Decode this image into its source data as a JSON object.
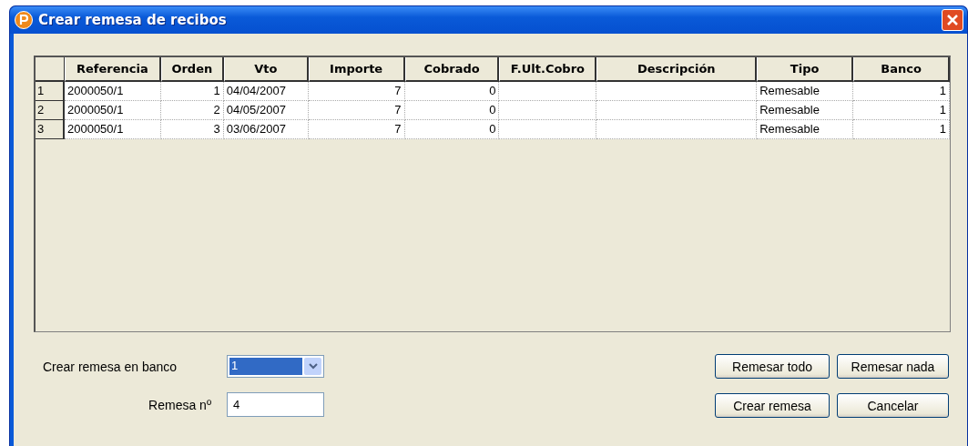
{
  "window": {
    "title": "Crear remesa de recibos"
  },
  "table": {
    "columns": [
      {
        "label": "Referencia",
        "kind": "text"
      },
      {
        "label": "Orden",
        "kind": "number"
      },
      {
        "label": "Vto",
        "kind": "text"
      },
      {
        "label": "Importe",
        "kind": "number"
      },
      {
        "label": "Cobrado",
        "kind": "number"
      },
      {
        "label": "F.Ult.Cobro",
        "kind": "text"
      },
      {
        "label": "Descripción",
        "kind": "text"
      },
      {
        "label": "Tipo",
        "kind": "text"
      },
      {
        "label": "Banco",
        "kind": "number"
      }
    ],
    "rows": [
      {
        "number": "1",
        "cells": [
          "2000050/1",
          "1",
          "04/04/2007",
          "7",
          "0",
          "",
          "",
          "Remesable",
          "1"
        ]
      },
      {
        "number": "2",
        "cells": [
          "2000050/1",
          "2",
          "04/05/2007",
          "7",
          "0",
          "",
          "",
          "Remesable",
          "1"
        ]
      },
      {
        "number": "3",
        "cells": [
          "2000050/1",
          "3",
          "03/06/2007",
          "7",
          "0",
          "",
          "",
          "Remesable",
          "1"
        ]
      }
    ]
  },
  "form": {
    "bank": {
      "label": "Crear remesa en banco",
      "value": "1"
    },
    "remesa": {
      "label": "Remesa nº",
      "value": "4"
    }
  },
  "buttons": [
    "Remesar todo",
    "Remesar nada",
    "Crear remesa",
    "Cancelar"
  ]
}
